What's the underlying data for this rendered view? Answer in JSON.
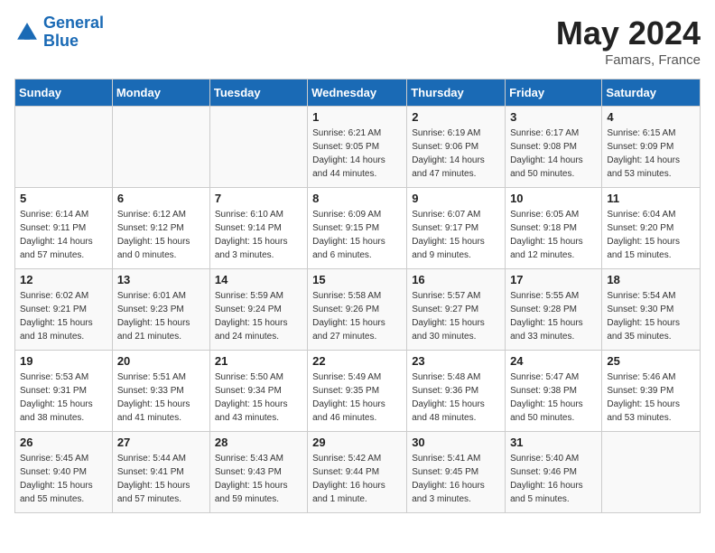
{
  "header": {
    "logo_line1": "General",
    "logo_line2": "Blue",
    "month": "May 2024",
    "location": "Famars, France"
  },
  "weekdays": [
    "Sunday",
    "Monday",
    "Tuesday",
    "Wednesday",
    "Thursday",
    "Friday",
    "Saturday"
  ],
  "weeks": [
    [
      null,
      null,
      null,
      {
        "day": 1,
        "sunrise": "6:21 AM",
        "sunset": "9:05 PM",
        "daylight": "14 hours and 44 minutes."
      },
      {
        "day": 2,
        "sunrise": "6:19 AM",
        "sunset": "9:06 PM",
        "daylight": "14 hours and 47 minutes."
      },
      {
        "day": 3,
        "sunrise": "6:17 AM",
        "sunset": "9:08 PM",
        "daylight": "14 hours and 50 minutes."
      },
      {
        "day": 4,
        "sunrise": "6:15 AM",
        "sunset": "9:09 PM",
        "daylight": "14 hours and 53 minutes."
      }
    ],
    [
      {
        "day": 5,
        "sunrise": "6:14 AM",
        "sunset": "9:11 PM",
        "daylight": "14 hours and 57 minutes."
      },
      {
        "day": 6,
        "sunrise": "6:12 AM",
        "sunset": "9:12 PM",
        "daylight": "15 hours and 0 minutes."
      },
      {
        "day": 7,
        "sunrise": "6:10 AM",
        "sunset": "9:14 PM",
        "daylight": "15 hours and 3 minutes."
      },
      {
        "day": 8,
        "sunrise": "6:09 AM",
        "sunset": "9:15 PM",
        "daylight": "15 hours and 6 minutes."
      },
      {
        "day": 9,
        "sunrise": "6:07 AM",
        "sunset": "9:17 PM",
        "daylight": "15 hours and 9 minutes."
      },
      {
        "day": 10,
        "sunrise": "6:05 AM",
        "sunset": "9:18 PM",
        "daylight": "15 hours and 12 minutes."
      },
      {
        "day": 11,
        "sunrise": "6:04 AM",
        "sunset": "9:20 PM",
        "daylight": "15 hours and 15 minutes."
      }
    ],
    [
      {
        "day": 12,
        "sunrise": "6:02 AM",
        "sunset": "9:21 PM",
        "daylight": "15 hours and 18 minutes."
      },
      {
        "day": 13,
        "sunrise": "6:01 AM",
        "sunset": "9:23 PM",
        "daylight": "15 hours and 21 minutes."
      },
      {
        "day": 14,
        "sunrise": "5:59 AM",
        "sunset": "9:24 PM",
        "daylight": "15 hours and 24 minutes."
      },
      {
        "day": 15,
        "sunrise": "5:58 AM",
        "sunset": "9:26 PM",
        "daylight": "15 hours and 27 minutes."
      },
      {
        "day": 16,
        "sunrise": "5:57 AM",
        "sunset": "9:27 PM",
        "daylight": "15 hours and 30 minutes."
      },
      {
        "day": 17,
        "sunrise": "5:55 AM",
        "sunset": "9:28 PM",
        "daylight": "15 hours and 33 minutes."
      },
      {
        "day": 18,
        "sunrise": "5:54 AM",
        "sunset": "9:30 PM",
        "daylight": "15 hours and 35 minutes."
      }
    ],
    [
      {
        "day": 19,
        "sunrise": "5:53 AM",
        "sunset": "9:31 PM",
        "daylight": "15 hours and 38 minutes."
      },
      {
        "day": 20,
        "sunrise": "5:51 AM",
        "sunset": "9:33 PM",
        "daylight": "15 hours and 41 minutes."
      },
      {
        "day": 21,
        "sunrise": "5:50 AM",
        "sunset": "9:34 PM",
        "daylight": "15 hours and 43 minutes."
      },
      {
        "day": 22,
        "sunrise": "5:49 AM",
        "sunset": "9:35 PM",
        "daylight": "15 hours and 46 minutes."
      },
      {
        "day": 23,
        "sunrise": "5:48 AM",
        "sunset": "9:36 PM",
        "daylight": "15 hours and 48 minutes."
      },
      {
        "day": 24,
        "sunrise": "5:47 AM",
        "sunset": "9:38 PM",
        "daylight": "15 hours and 50 minutes."
      },
      {
        "day": 25,
        "sunrise": "5:46 AM",
        "sunset": "9:39 PM",
        "daylight": "15 hours and 53 minutes."
      }
    ],
    [
      {
        "day": 26,
        "sunrise": "5:45 AM",
        "sunset": "9:40 PM",
        "daylight": "15 hours and 55 minutes."
      },
      {
        "day": 27,
        "sunrise": "5:44 AM",
        "sunset": "9:41 PM",
        "daylight": "15 hours and 57 minutes."
      },
      {
        "day": 28,
        "sunrise": "5:43 AM",
        "sunset": "9:43 PM",
        "daylight": "15 hours and 59 minutes."
      },
      {
        "day": 29,
        "sunrise": "5:42 AM",
        "sunset": "9:44 PM",
        "daylight": "16 hours and 1 minute."
      },
      {
        "day": 30,
        "sunrise": "5:41 AM",
        "sunset": "9:45 PM",
        "daylight": "16 hours and 3 minutes."
      },
      {
        "day": 31,
        "sunrise": "5:40 AM",
        "sunset": "9:46 PM",
        "daylight": "16 hours and 5 minutes."
      },
      null
    ]
  ]
}
